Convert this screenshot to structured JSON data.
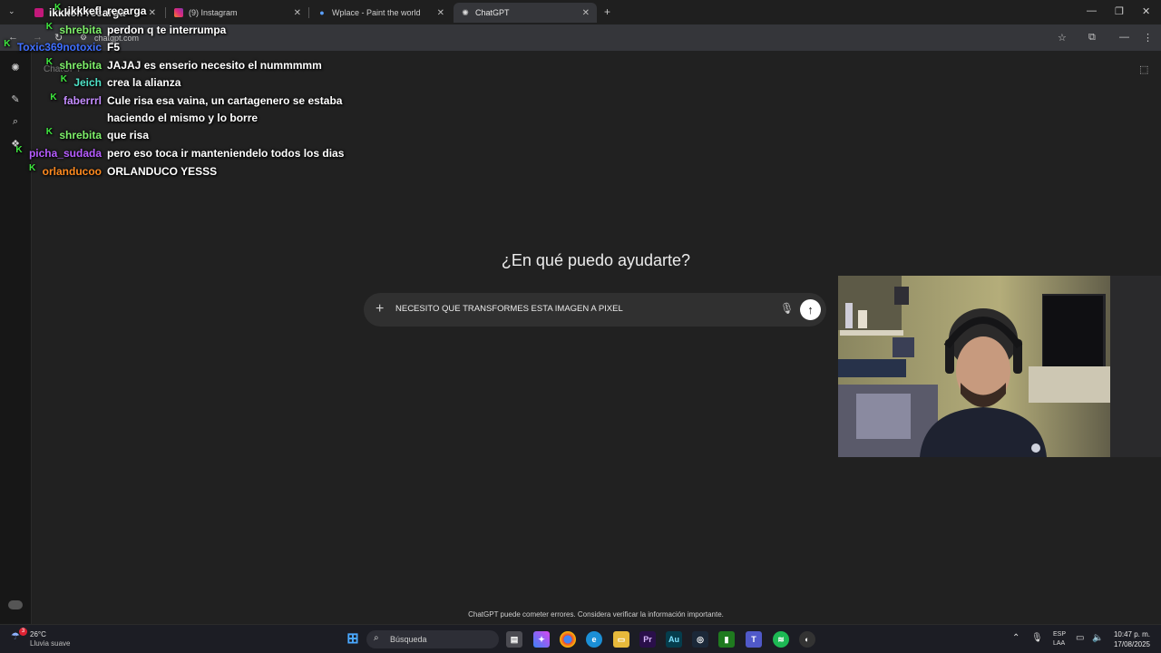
{
  "browser": {
    "tabs": [
      {
        "label": "ikkkefl recarga",
        "active": false
      },
      {
        "label": "(9) Instagram",
        "active": false
      },
      {
        "label": "Wplace - Paint the world",
        "active": false
      },
      {
        "label": "ChatGPT",
        "active": true
      }
    ],
    "new_tab": "+",
    "url": "chatgpt.com",
    "controls": {
      "minimize": "—",
      "restore": "❐",
      "close": "✕"
    }
  },
  "chat_overlay": [
    {
      "user": "ikkkefl",
      "message": "recarga",
      "user_color": "#ffffff"
    },
    {
      "user": "shrebita",
      "message": "perdon q te interrumpa",
      "user_color": "#7ef06a"
    },
    {
      "user": "Toxic369notoxic",
      "message": "F5",
      "user_color": "#3f6fff"
    },
    {
      "user": "shrebita",
      "message": "JAJAJ es enserio necesito el nummmmm",
      "user_color": "#7ef06a"
    },
    {
      "user": "Jeich",
      "message": "crea la alianza",
      "user_color": "#4fe3c8"
    },
    {
      "user": "faberrrl",
      "message": "Cule risa esa vaina, un cartagenero se estaba",
      "message2": "haciendo el mismo y lo borre",
      "user_color": "#c48cff"
    },
    {
      "user": "shrebita",
      "message": "que risa",
      "user_color": "#7ef06a"
    },
    {
      "user": "picha_sudada",
      "message": "pero eso toca ir manteniendelo todos los dias",
      "user_color": "#b65cff"
    },
    {
      "user": "orlanducoo",
      "message": "ORLANDUCO YESSS",
      "user_color": "#ff8a1f"
    }
  ],
  "chatgpt": {
    "sidebar_label": "ChatGPT",
    "greeting": "¿En qué puedo ayudarte?",
    "composer_value": "NECESITO QUE TRANSFORMES ESTA IMAGEN A PIXEL",
    "disclaimer": "ChatGPT puede cometer errores. Considera verificar la información importante."
  },
  "taskbar": {
    "weather_temp": "26°C",
    "weather_desc": "Lluvia suave",
    "notifications": "3",
    "search_placeholder": "Búsqueda",
    "lang_1": "ESP",
    "lang_2": "LAA",
    "time": "10:47 p. m.",
    "date": "17/08/2025"
  },
  "colors": {
    "background": "#212121",
    "sidebar": "#171717",
    "composer": "#303030",
    "taskbar": "#1c1d24"
  }
}
